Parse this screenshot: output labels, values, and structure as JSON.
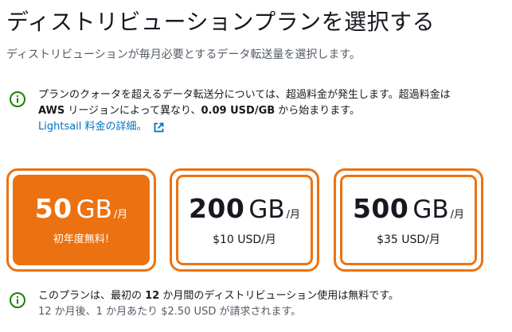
{
  "header": {
    "title": "ディストリビューションプランを選択する",
    "subtitle": "ディストリビューションが毎月必要とするデータ転送量を選択します。"
  },
  "notice_overage": {
    "text_part1": "プランのクォータを超えるデータ転送分については、超過料金が発生します。超過料金は",
    "aws": "AWS",
    "text_part2": " リージョンによって異なり、",
    "price": "0.09 USD/GB",
    "text_part3": " から始まります。",
    "link_label": "Lightsail 料金の詳細。"
  },
  "plans": [
    {
      "size": "50",
      "unit": "GB",
      "per": "/月",
      "sub": "初年度無料!",
      "selected": true
    },
    {
      "size": "200",
      "unit": "GB",
      "per": "/月",
      "sub": "$10 USD/月",
      "selected": false
    },
    {
      "size": "500",
      "unit": "GB",
      "per": "/月",
      "sub": "$35 USD/月",
      "selected": false
    }
  ],
  "notice_free": {
    "line1_part1": "このプランは、最初の ",
    "line1_months": "12",
    "line1_part2": " か月間のディストリビューション使用は無料です。",
    "line2": "12 か月後、1 か月あたり $2.50 USD が請求されます。"
  },
  "colors": {
    "accent": "#ec7211",
    "info_green": "#1d8102",
    "link_blue": "#0073bb",
    "text": "#16191f",
    "secondary_text": "#545b64"
  }
}
